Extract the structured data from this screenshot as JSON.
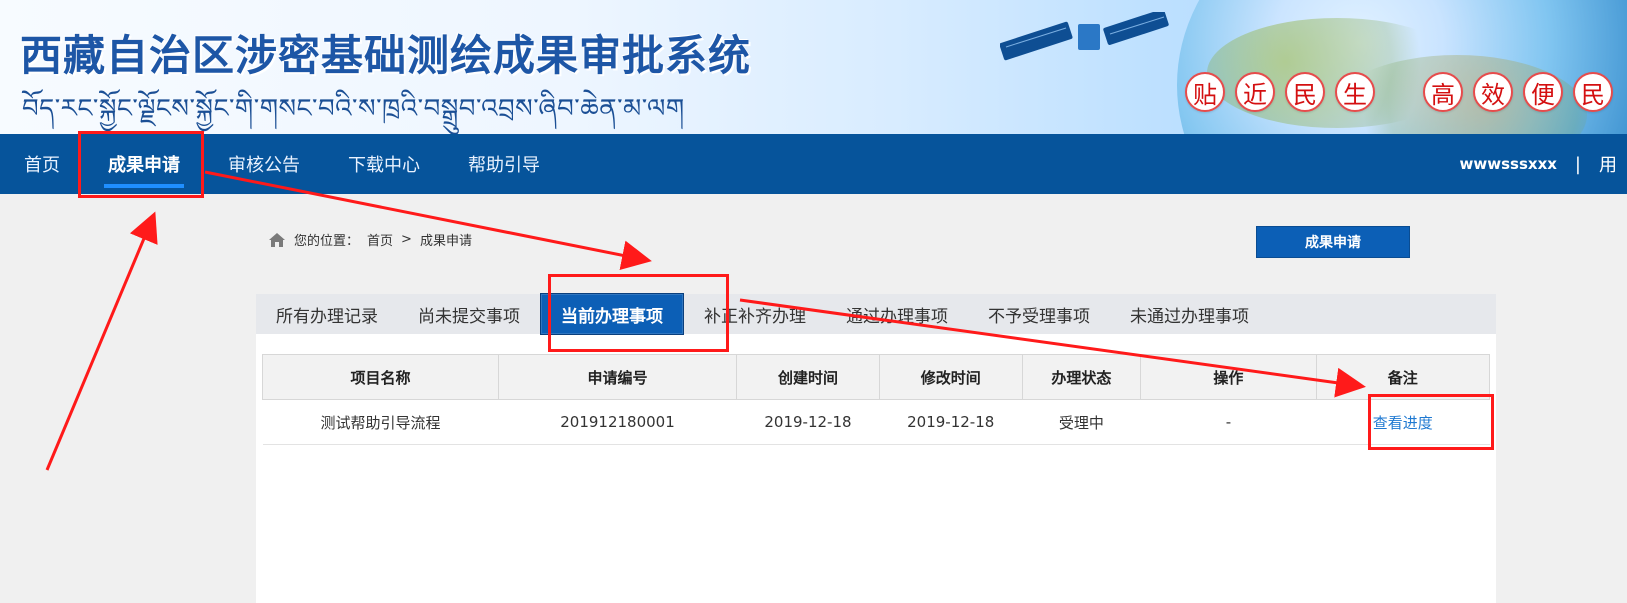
{
  "header": {
    "title": "西藏自治区涉密基础测绘成果审批系统",
    "tibetan": "བོད་རང་སྐྱོང་ལྗོངས་སྐྱོང་གི་གསང་བའི་ས་ཁྲའི་བསྒྲུབ་འབྲས་ཞིབ་ཆེན་མ་ལག",
    "slogan1": [
      "贴",
      "近",
      "民",
      "生"
    ],
    "slogan2": [
      "高",
      "效",
      "便",
      "民"
    ]
  },
  "nav": {
    "items": [
      "首页",
      "成果申请",
      "审核公告",
      "下载中心",
      "帮助引导"
    ],
    "user": "wwwsssxxx",
    "separator": "|",
    "cut_text": "用"
  },
  "breadcrumb": {
    "prefix": "您的位置：",
    "home": "首页",
    "arrow": ">",
    "current": "成果申请"
  },
  "buttons": {
    "apply": "成果申请"
  },
  "tabs": [
    "所有办理记录",
    "尚未提交事项",
    "当前办理事项",
    "补正补齐办理",
    "通过办理事项",
    "不予受理事项",
    "未通过办理事项"
  ],
  "table": {
    "headers": [
      "项目名称",
      "申请编号",
      "创建时间",
      "修改时间",
      "办理状态",
      "操作",
      "备注"
    ],
    "rows": [
      [
        "测试帮助引导流程",
        "201912180001",
        "2019-12-18",
        "2019-12-18",
        "受理中",
        "-",
        "查看进度"
      ]
    ]
  },
  "colors": {
    "nav_bg": "#06549b",
    "tab_active": "#0c5fb6",
    "annotation": "#ff1a1a",
    "link": "#1f79d1"
  }
}
